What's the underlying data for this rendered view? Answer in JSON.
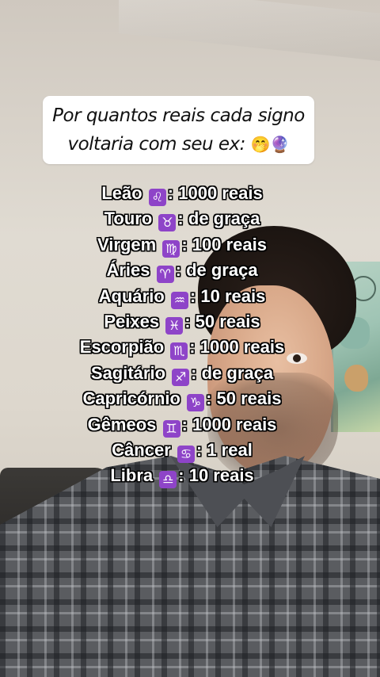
{
  "title": {
    "line1": "Por quantos reais cada signo",
    "line2": "voltaria com seu ex:",
    "emoji": "🤭🔮"
  },
  "signs": [
    {
      "name": "Leão",
      "glyph": "♌",
      "sep": ":",
      "value": "1000 reais"
    },
    {
      "name": "Touro",
      "glyph": "♉",
      "sep": ":",
      "value": "de graça"
    },
    {
      "name": "Virgem",
      "glyph": "♍",
      "sep": ":",
      "value": "100 reais"
    },
    {
      "name": "Áries",
      "glyph": "♈",
      "sep": ":",
      "value": "de graça"
    },
    {
      "name": "Aquário",
      "glyph": "♒",
      "sep": ":",
      "value": "10 reais"
    },
    {
      "name": "Peixes",
      "glyph": "♓",
      "sep": ":",
      "value": "50 reais"
    },
    {
      "name": "Escorpião",
      "glyph": "♏",
      "sep": ":",
      "value": "1000 reais"
    },
    {
      "name": "Sagitário",
      "glyph": "♐",
      "sep": ":",
      "value": "de graça"
    },
    {
      "name": "Capricórnio",
      "glyph": "♑",
      "sep": ":",
      "value": "50 reais"
    },
    {
      "name": "Gêmeos",
      "glyph": "♊",
      "sep": ":",
      "value": "1000 reais"
    },
    {
      "name": "Câncer",
      "glyph": "♋",
      "sep": ":",
      "value": "1 real"
    },
    {
      "name": "Libra",
      "glyph": "♎",
      "sep": ":",
      "value": "10 reais"
    }
  ],
  "colors": {
    "sign_badge": "#8e44c8",
    "list_text": "#ffffff",
    "list_outline": "#000000",
    "card_bg": "#ffffff"
  }
}
